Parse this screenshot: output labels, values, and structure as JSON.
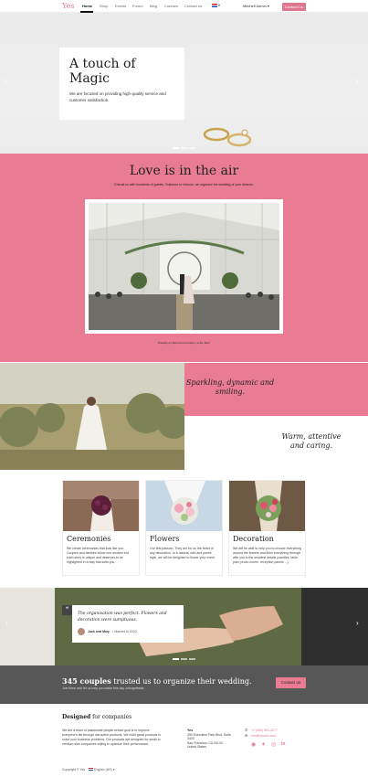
{
  "header": {
    "logo": "Yes",
    "nav": [
      "Home",
      "Shop",
      "Events",
      "Forum",
      "Blog",
      "Courses",
      "Contact us"
    ],
    "user": "Mitchell Admin ▾",
    "cta": "Contact Us"
  },
  "hero": {
    "title": "A touch of Magic",
    "text": "We are focused on providing high-quality service and customer satisfaction."
  },
  "love": {
    "title": "Love is in the air",
    "subtitle": "Entrust us with hundreds of guests. Outdoors or indoors, we organize the wedding of your dreams.",
    "caption": "Wedding of Bernard and Marie, at the Barn"
  },
  "split": {
    "pink_text": "Sparkling, dynamic and smiling.",
    "white_text": "Warm, attentive and caring."
  },
  "services": [
    {
      "title": "Ceremonies",
      "text": "We create ceremonies that look like you. Couples and families follow one another but each story is unique and deserves to be highlighted in a way that suits you."
    },
    {
      "title": "Flowers",
      "text": "Our first passion. They are for us the heart of any decoration. In a natural, wild and poetic style, we will be delighted to flower your event."
    },
    {
      "title": "Decoration",
      "text": "We will be able to help you to choose everything around the flowers and think everything through with you in the smallest details (candles, table plan, photo corner, reception panels ...)."
    }
  ],
  "testimonial": {
    "quote": "The organisation was perfect. Flowers and decoration were sumptuous.",
    "author": "Jack and Mary",
    "date": " • Married in 2020"
  },
  "stats": {
    "count": "345 couples",
    "line_rest": " trusted us to organize their wedding.",
    "sub": "Join them and let us help you make this day unforgettable.",
    "cta": "Contact us"
  },
  "footer": {
    "title_bold": "Designed",
    "title_rest": " for companies",
    "text": "We are a team of passionate people whose goal is to improve everyone's life through disruptive products. We build great products to solve your business problems. Our products are designed for small to medium size companies willing to optimize their performance.",
    "company": "Yes",
    "address": [
      "250 Executive Park Blvd, Suite",
      "3400",
      "San Francisco CA 94134",
      "United States"
    ],
    "phone": "+1 (650) 691-3277",
    "email": "info@yourco.com",
    "copyright": "Copyright © Yes",
    "language": "English (US) ▾"
  },
  "colors": {
    "accent": "#e97c92",
    "band": "#575757"
  }
}
